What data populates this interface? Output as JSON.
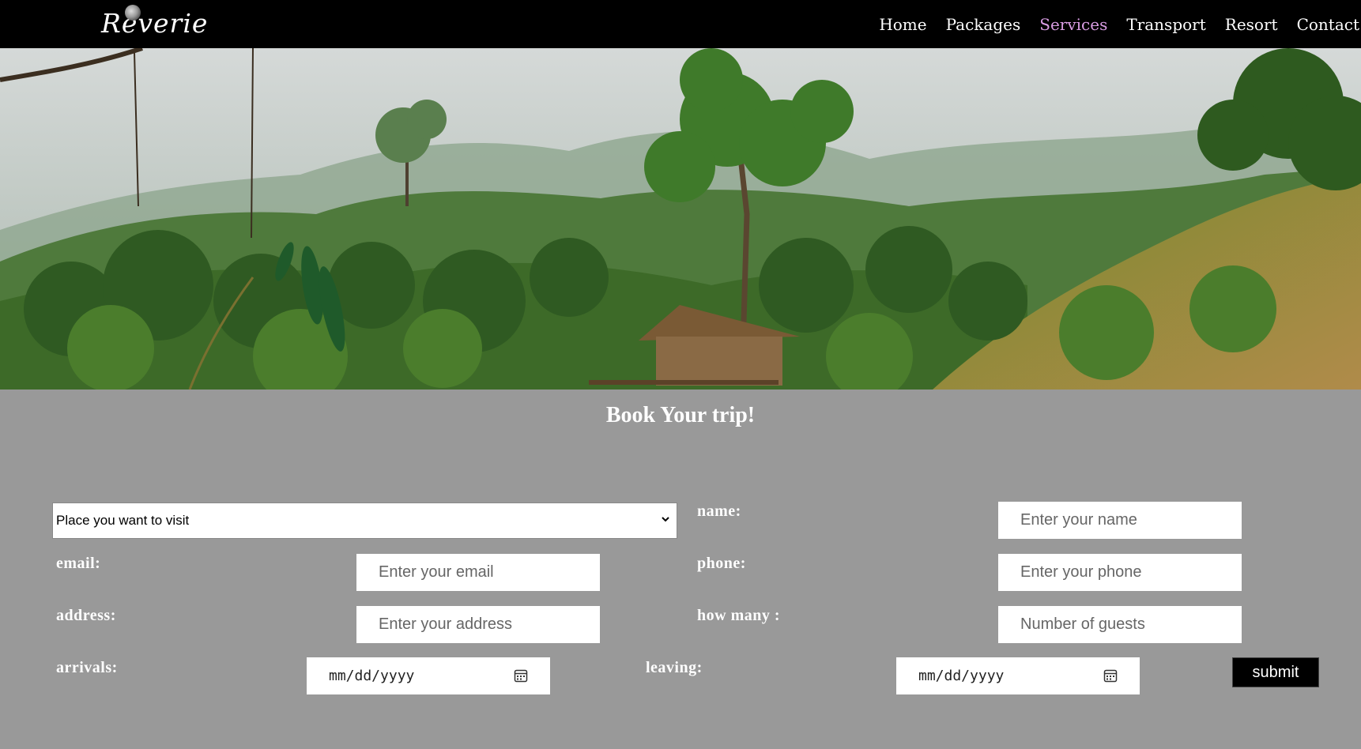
{
  "brand": {
    "logo_text": "Reverie"
  },
  "nav": {
    "items": [
      {
        "label": "Home"
      },
      {
        "label": "Packages"
      },
      {
        "label": "Services"
      },
      {
        "label": "Transport"
      },
      {
        "label": "Resort"
      },
      {
        "label": "Contact"
      }
    ],
    "active": "Services",
    "active_color": "#d99de3"
  },
  "booking": {
    "title": "Book Your trip!",
    "place_select": {
      "value": "Place you want to visit"
    },
    "name": {
      "label": "name:",
      "placeholder": "Enter your name"
    },
    "email": {
      "label": "email:",
      "placeholder": "Enter your email"
    },
    "phone": {
      "label": "phone:",
      "placeholder": "Enter your phone"
    },
    "address": {
      "label": "address:",
      "placeholder": "Enter your address"
    },
    "guests": {
      "label": "how many :",
      "placeholder": "Number of guests"
    },
    "arrivals": {
      "label": "arrivals:",
      "value": "mm/dd/yyyy"
    },
    "leaving": {
      "label": "leaving:",
      "value": "mm/dd/yyyy"
    },
    "submit_label": "submit"
  },
  "colors": {
    "background": "#999999",
    "navbar": "#000000"
  },
  "icons": {
    "select_arrow": "chevron-down-icon",
    "date_picker": "calendar-icon"
  }
}
